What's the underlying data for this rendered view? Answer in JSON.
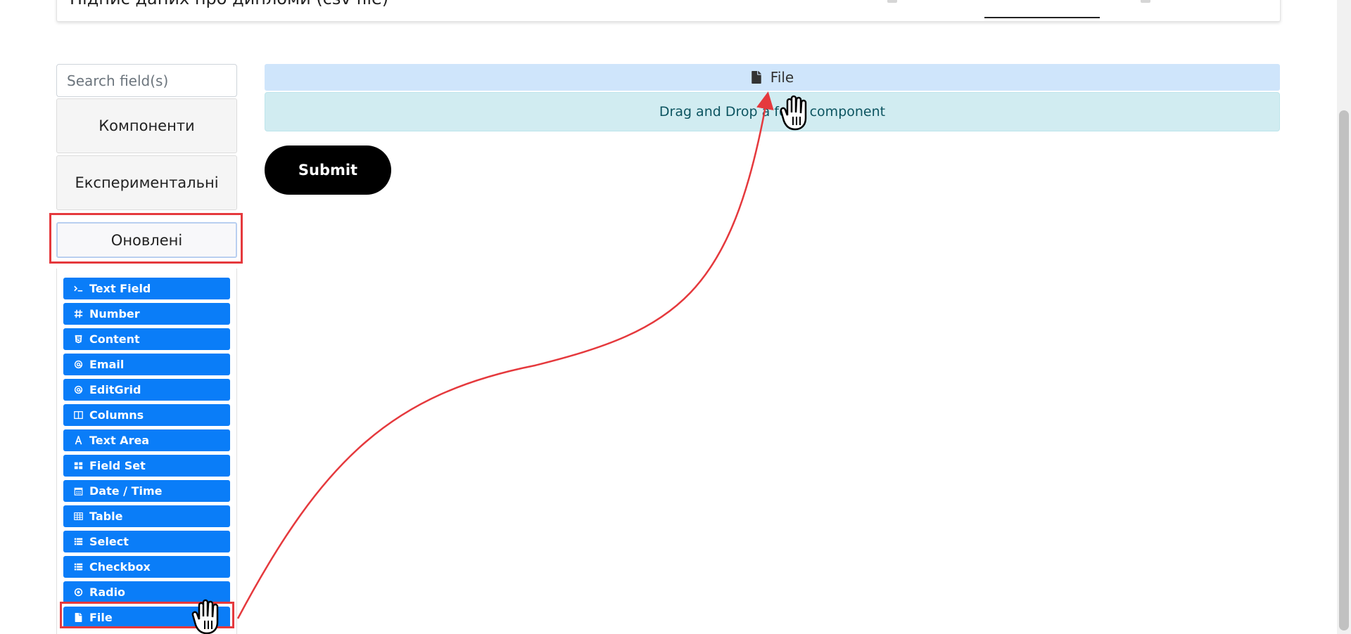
{
  "header": {
    "title": "Підпис даних про дипломи (csv file)"
  },
  "sidebar": {
    "search_placeholder": "Search field(s)",
    "groups": [
      {
        "label": "Компоненти"
      },
      {
        "label": "Експериментальні"
      },
      {
        "label": "Оновлені"
      }
    ],
    "components": [
      {
        "label": "Text Field",
        "icon": "terminal-icon"
      },
      {
        "label": "Number",
        "icon": "hashtag-icon"
      },
      {
        "label": "Content",
        "icon": "html5-icon"
      },
      {
        "label": "Email",
        "icon": "at-icon"
      },
      {
        "label": "EditGrid",
        "icon": "at-icon"
      },
      {
        "label": "Columns",
        "icon": "columns-icon"
      },
      {
        "label": "Text Area",
        "icon": "font-icon"
      },
      {
        "label": "Field Set",
        "icon": "th-large-icon"
      },
      {
        "label": "Date / Time",
        "icon": "calendar-icon"
      },
      {
        "label": "Table",
        "icon": "table-icon"
      },
      {
        "label": "Select",
        "icon": "th-list-icon"
      },
      {
        "label": "Checkbox",
        "icon": "th-list-icon"
      },
      {
        "label": "Radio",
        "icon": "dot-circle-icon"
      },
      {
        "label": "File",
        "icon": "file-icon"
      }
    ]
  },
  "canvas": {
    "file_component_label": "File",
    "dropzone_text": "Drag and Drop a form component",
    "submit_label": "Submit"
  },
  "colors": {
    "component_blue": "#0a7df8",
    "file_header_bg": "#cfe5fb",
    "dropzone_bg": "#d1ecf1",
    "annotation_red": "#e5393d"
  }
}
